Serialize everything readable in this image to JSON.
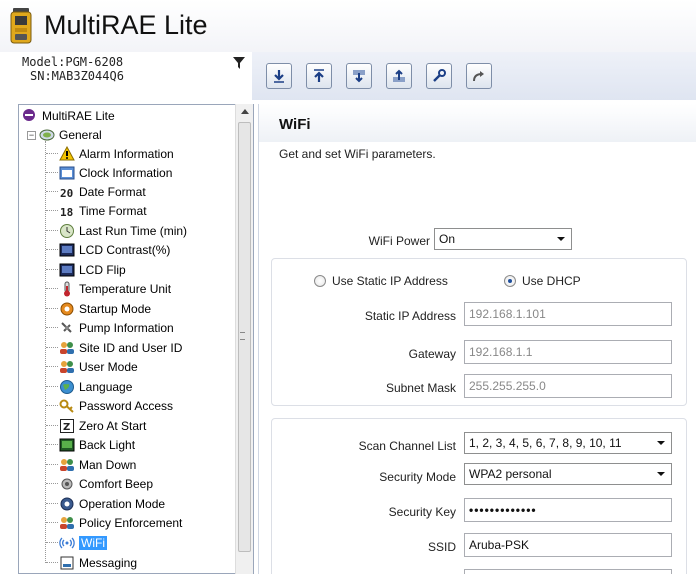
{
  "app": {
    "title": "MultiRAE Lite"
  },
  "device": {
    "model": "Model:PGM-6208",
    "sn": "SN:MAB3Z044Q6"
  },
  "toolbar": {
    "buttons": [
      {
        "icon": "download-icon"
      },
      {
        "icon": "upload-icon"
      },
      {
        "icon": "download-all-icon"
      },
      {
        "icon": "upload-all-icon"
      },
      {
        "icon": "wrench-icon"
      },
      {
        "icon": "redo-icon"
      }
    ]
  },
  "tree": {
    "root": "MultiRAE Lite",
    "group": "General",
    "items": [
      "Alarm Information",
      "Clock Information",
      "Date Format",
      "Time Format",
      "Last Run Time (min)",
      "LCD Contrast(%)",
      "LCD Flip",
      "Temperature Unit",
      "Startup Mode",
      "Pump Information",
      "Site ID and User ID",
      "User Mode",
      "Language",
      "Password Access",
      "Zero At Start",
      "Back Light",
      "Man Down",
      "Comfort Beep",
      "Operation Mode",
      "Policy Enforcement",
      "WiFi",
      "Messaging"
    ],
    "selected": "WiFi"
  },
  "panel": {
    "title": "WiFi",
    "description": "Get and set WiFi parameters.",
    "wifi_power": {
      "label": "WiFi Power",
      "value": "On"
    },
    "ip_mode": {
      "static_label": "Use Static IP Address",
      "dhcp_label": "Use DHCP",
      "selected": "dhcp"
    },
    "static_ip": {
      "label": "Static IP Address",
      "value": "192.168.1.101"
    },
    "gateway": {
      "label": "Gateway",
      "value": "192.168.1.1"
    },
    "subnet": {
      "label": "Subnet Mask",
      "value": "255.255.255.0"
    },
    "scan_channels": {
      "label": "Scan Channel List",
      "value": "1, 2, 3, 4, 5, 6, 7, 8, 9, 10, 11"
    },
    "security_mode": {
      "label": "Security Mode",
      "value": "WPA2 personal"
    },
    "security_key": {
      "label": "Security Key",
      "value": "•••••••••••••"
    },
    "ssid": {
      "label": "SSID",
      "value": "Aruba-PSK"
    }
  },
  "colors": {
    "selection": "#3399ff",
    "toolbar_bg": "#e6ebf4"
  }
}
